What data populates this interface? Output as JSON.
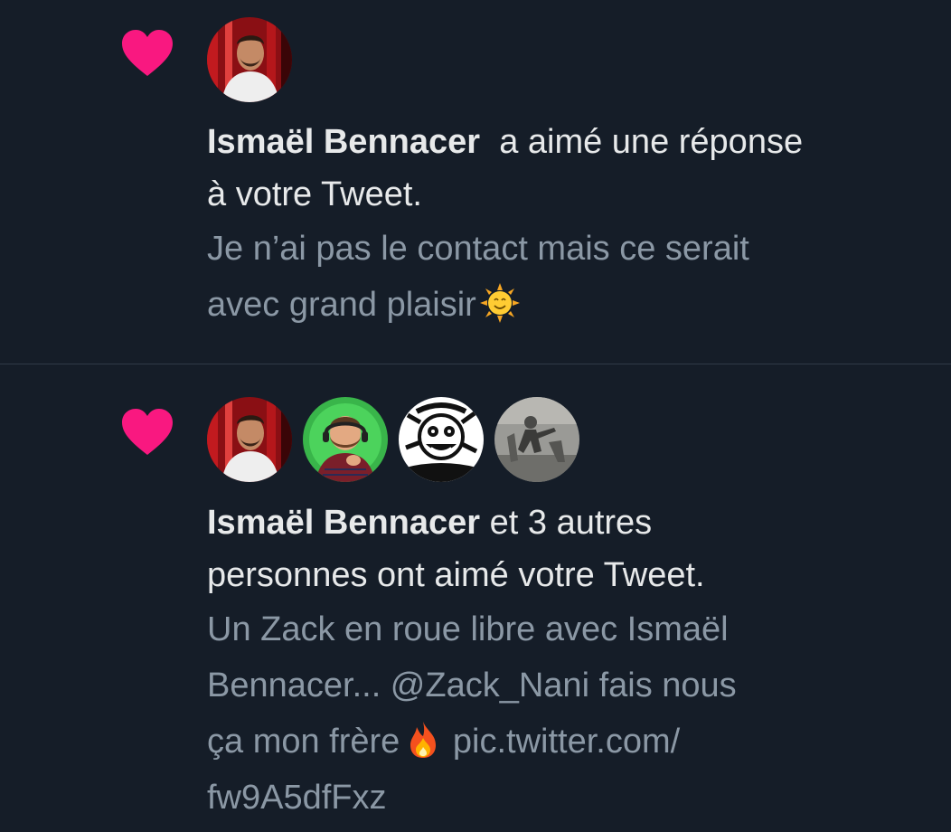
{
  "colors": {
    "background": "#151d28",
    "heart": "#f91880",
    "primary_text": "#e7e9ea",
    "secondary_text": "#8b98a5",
    "divider": "#2f3b47"
  },
  "notifications": [
    {
      "icon": "heart-icon",
      "avatars": [
        "avatar-ismael-bennacer"
      ],
      "user_name": "Ismaël Bennacer",
      "action_line1": "a aimé une réponse",
      "action_line2": "à votre Tweet.",
      "preview_line1": "Je n’ai pas le contact mais ce serait",
      "preview_line2": "avec grand plaisir",
      "preview_emoji": "sun-with-face-emoji"
    },
    {
      "icon": "heart-icon",
      "avatars": [
        "avatar-ismael-bennacer",
        "avatar-bearded-man-headset",
        "avatar-manga-character",
        "avatar-vintage-photo"
      ],
      "user_name": "Ismaël Bennacer",
      "action_line1": "et 3 autres",
      "action_line2": "personnes ont aimé votre Tweet.",
      "preview_line1": "Un Zack en roue libre avec Ismaël",
      "preview_line2": "Bennacer... @Zack_Nani fais nous",
      "preview_line3a": "ça mon frère",
      "preview_emoji": "fire-emoji",
      "preview_line3b": "pic.twitter.com/",
      "preview_line4": "fw9A5dfFxz"
    }
  ]
}
